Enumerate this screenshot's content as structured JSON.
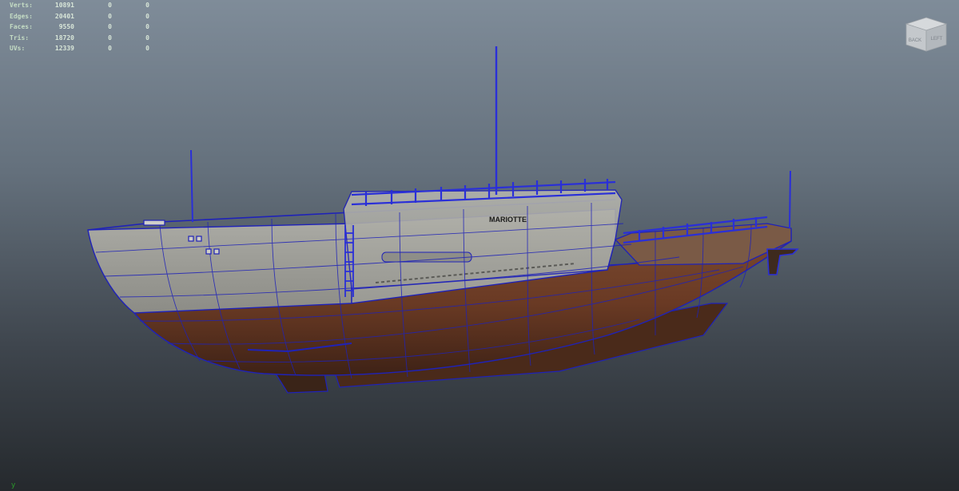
{
  "stats_hud": {
    "rows": [
      {
        "label": "Verts:",
        "values": [
          "10891",
          "0",
          "0"
        ]
      },
      {
        "label": "Edges:",
        "values": [
          "20401",
          "0",
          "0"
        ]
      },
      {
        "label": "Faces:",
        "values": [
          "9550",
          "0",
          "0"
        ]
      },
      {
        "label": "Tris:",
        "values": [
          "18720",
          "0",
          "0"
        ]
      },
      {
        "label": "UVs:",
        "values": [
          "12339",
          "0",
          "0"
        ]
      }
    ]
  },
  "viewcube": {
    "left_face": "BACK",
    "right_face": "LEFT"
  },
  "model": {
    "ship_name": "MARIOTTE"
  },
  "axis": {
    "label": "y"
  },
  "colors": {
    "background_top": "#7f8c99",
    "background_bottom": "#25292d",
    "wireframe": "#1f22b8",
    "hull_upper": "#9c9c96",
    "hull_lower": "#6a3a24",
    "hud_text": "#d8e6d8",
    "axis_y": "#2a9a2a"
  }
}
